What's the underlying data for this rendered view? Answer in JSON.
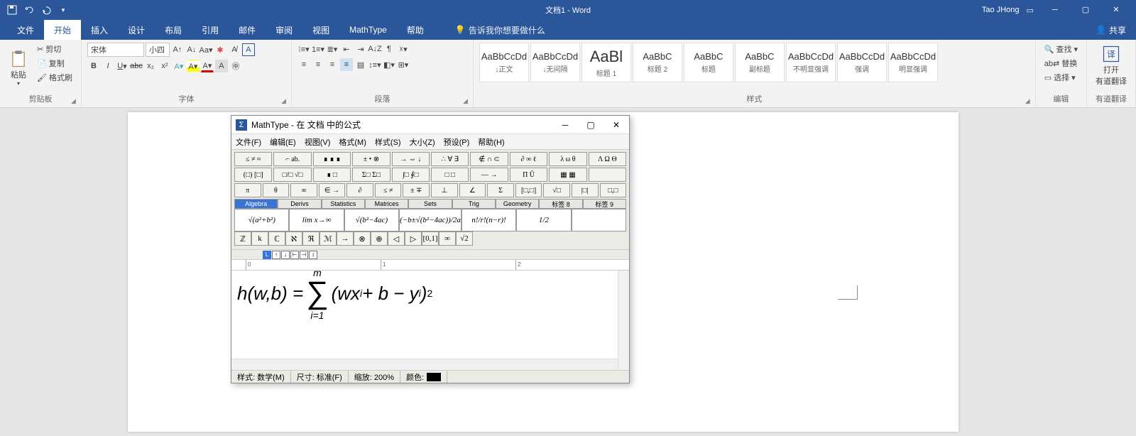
{
  "titlebar": {
    "doc_title": "文档1 - Word",
    "user": "Tao JHong"
  },
  "tabs": {
    "file": "文件",
    "home": "开始",
    "insert": "插入",
    "design": "设计",
    "layout": "布局",
    "references": "引用",
    "mail": "邮件",
    "review": "审阅",
    "view": "视图",
    "mathtype": "MathType",
    "help": "帮助",
    "tell": "告诉我你想要做什么",
    "share": "共享"
  },
  "groups": {
    "clipboard": "剪贴板",
    "font": "字体",
    "para": "段落",
    "styles": "样式",
    "edit": "编辑",
    "youdao": "有道翻译"
  },
  "clipboard": {
    "paste": "粘贴",
    "cut": "剪切",
    "copy": "复制",
    "format": "格式刷"
  },
  "font": {
    "name": "宋体",
    "size": "小四"
  },
  "styles": [
    {
      "prev": "AaBbCcDd",
      "lbl": "↓正文"
    },
    {
      "prev": "AaBbCcDd",
      "lbl": "↓无间隔"
    },
    {
      "prev": "AaBl",
      "lbl": "标题 1",
      "big": true
    },
    {
      "prev": "AaBbC",
      "lbl": "标题 2"
    },
    {
      "prev": "AaBbC",
      "lbl": "标题"
    },
    {
      "prev": "AaBbC",
      "lbl": "副标题"
    },
    {
      "prev": "AaBbCcDd",
      "lbl": "不明显强调"
    },
    {
      "prev": "AaBbCcDd",
      "lbl": "强调"
    },
    {
      "prev": "AaBbCcDd",
      "lbl": "明显强调"
    }
  ],
  "edit": {
    "find": "查找",
    "replace": "替换",
    "select": "选择"
  },
  "youdao": {
    "open": "打开",
    "label": "有道翻译"
  },
  "mathtype": {
    "title": "MathType - 在 文档 中的公式",
    "menu": {
      "file": "文件(F)",
      "edit": "编辑(E)",
      "view": "视图(V)",
      "format": "格式(M)",
      "style": "样式(S)",
      "size": "大小(Z)",
      "preset": "预设(P)",
      "help": "帮助(H)"
    },
    "pal_row1": [
      "≤ ≠ ≈",
      "⌐ ab.",
      "∎ ∎ ∎",
      "± • ⊗",
      "→ ⇔ ↓",
      "∴ ∀ ∃",
      "∉ ∩ ⊂",
      "∂ ∞ ℓ",
      "λ ω θ",
      "Λ Ω Θ"
    ],
    "pal_row2": [
      "(□) [□]",
      "□/□ √□",
      "∎ □",
      "Σ□ Σ□",
      "∫□ ∮□",
      "□ □",
      "— →",
      "Π Ū",
      "▦ ▦",
      ""
    ],
    "pal_row3": [
      "π",
      "θ",
      "∞",
      "∈ →",
      "∂",
      "≤ ≠",
      "± ∓",
      "⊥",
      "∠",
      "Σ",
      "[□,□]",
      "√□",
      "|□|",
      "□,□"
    ],
    "ptabs": [
      "Algebra",
      "Derivs",
      "Statistics",
      "Matrices",
      "Sets",
      "Trig",
      "Geometry",
      "标签 8",
      "标签 9"
    ],
    "tmpls": [
      "√(a²+b²)",
      "lim x→∞",
      "√(b²−4ac)",
      "(−b±√(b²−4ac))/2a",
      "n!/r!(n−r)!",
      "1/2",
      ""
    ],
    "syms": [
      "ℤ",
      "k",
      "ℂ",
      "ℵ",
      "ℜ",
      "ℳ",
      "→",
      "⊗",
      "⊕",
      "◁",
      "▷",
      "[0,1]",
      "∞",
      "√2"
    ],
    "ruler_marks": [
      "0",
      "1",
      "2"
    ],
    "formula": {
      "lhs": "h(w,b) = ",
      "sum_top": "m",
      "sum_bot": "i=1",
      "rhs_a": "(wx",
      "sub1": "i",
      "rhs_b": " + b − y",
      "sub2": "i",
      "rhs_c": ")",
      "sup": "2"
    },
    "status": {
      "style": "样式: 数学(M)",
      "size": "尺寸: 标准(F)",
      "zoom": "缩放: 200%",
      "color": "颜色:"
    }
  }
}
